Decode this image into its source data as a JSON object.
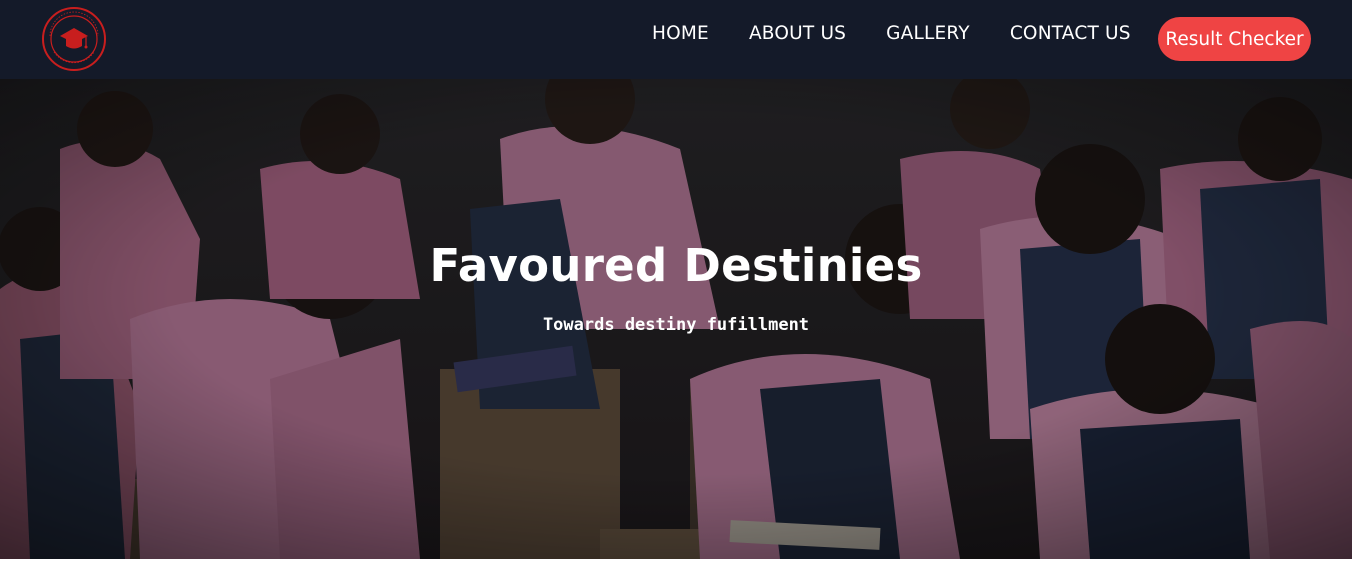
{
  "nav": {
    "logo_icon": "school-crest-logo",
    "links": [
      "HOME",
      "ABOUT US",
      "GALLERY",
      "CONTACT US"
    ],
    "cta_label": "Result Checker"
  },
  "hero": {
    "title": "Favoured Destinies",
    "subtitle": "Towards destiny fufillment",
    "background": "classroom-students-photo"
  },
  "colors": {
    "navbar": "#141a29",
    "cta": "#ef4444",
    "text": "#ffffff"
  }
}
